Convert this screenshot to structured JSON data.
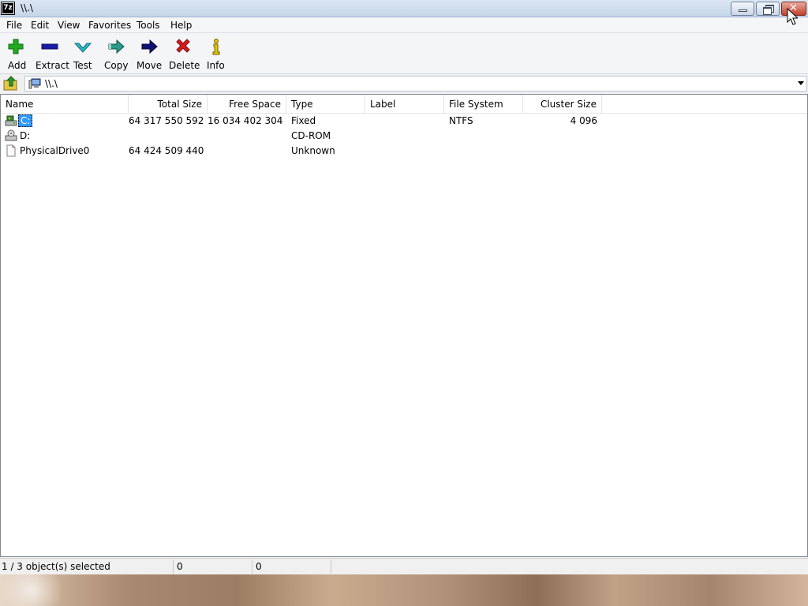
{
  "window": {
    "title": "\\\\.\\",
    "app_icon_text": "7z",
    "minimize_icon": "minimize-icon",
    "maximize_icon": "restore-icon",
    "close_icon": "close-icon",
    "close_glyph": "✕"
  },
  "menubar": {
    "items": [
      {
        "label": "File"
      },
      {
        "label": "Edit"
      },
      {
        "label": "View"
      },
      {
        "label": "Favorites"
      },
      {
        "label": "Tools"
      },
      {
        "label": "Help"
      }
    ]
  },
  "toolbar": {
    "buttons": [
      {
        "label": "Add",
        "icon": "plus-icon",
        "color": "#22aa22"
      },
      {
        "label": "Extract",
        "icon": "minus-icon",
        "color": "#1a1aa8"
      },
      {
        "label": "Test",
        "icon": "check-icon",
        "color": "#2ab8c8"
      },
      {
        "label": "Copy",
        "icon": "copy-arrow-icon",
        "color": "#2a9a8a"
      },
      {
        "label": "Move",
        "icon": "move-arrow-icon",
        "color": "#101070"
      },
      {
        "label": "Delete",
        "icon": "delete-x-icon",
        "color": "#d81c1c"
      },
      {
        "label": "Info",
        "icon": "info-icon",
        "color": "#c8a800"
      }
    ]
  },
  "address": {
    "path": "\\\\.\\",
    "up_icon": "folder-up-icon",
    "computer_icon": "computer-icon"
  },
  "list": {
    "columns": [
      {
        "label": "Name"
      },
      {
        "label": "Total Size"
      },
      {
        "label": "Free Space"
      },
      {
        "label": "Type"
      },
      {
        "label": "Label"
      },
      {
        "label": "File System"
      },
      {
        "label": "Cluster Size"
      }
    ],
    "rows": [
      {
        "name": "C:",
        "icon": "hard-drive-icon",
        "total_size": "64 317 550 592",
        "free_space": "16 034 402 304",
        "type": "Fixed",
        "label": "",
        "file_system": "NTFS",
        "cluster_size": "4 096",
        "selected": true
      },
      {
        "name": "D:",
        "icon": "cd-drive-icon",
        "total_size": "",
        "free_space": "",
        "type": "CD-ROM",
        "label": "",
        "file_system": "",
        "cluster_size": "",
        "selected": false
      },
      {
        "name": "PhysicalDrive0",
        "icon": "file-icon",
        "total_size": "64 424 509 440",
        "free_space": "",
        "type": "Unknown",
        "label": "",
        "file_system": "",
        "cluster_size": "",
        "selected": false
      }
    ]
  },
  "status": {
    "selection": "1 / 3 object(s) selected",
    "size": "0",
    "packed": "0"
  },
  "colors": {
    "selection_bg": "#3399ff",
    "titlebar": "#c6d6ea",
    "close_button": "#c0412b"
  }
}
